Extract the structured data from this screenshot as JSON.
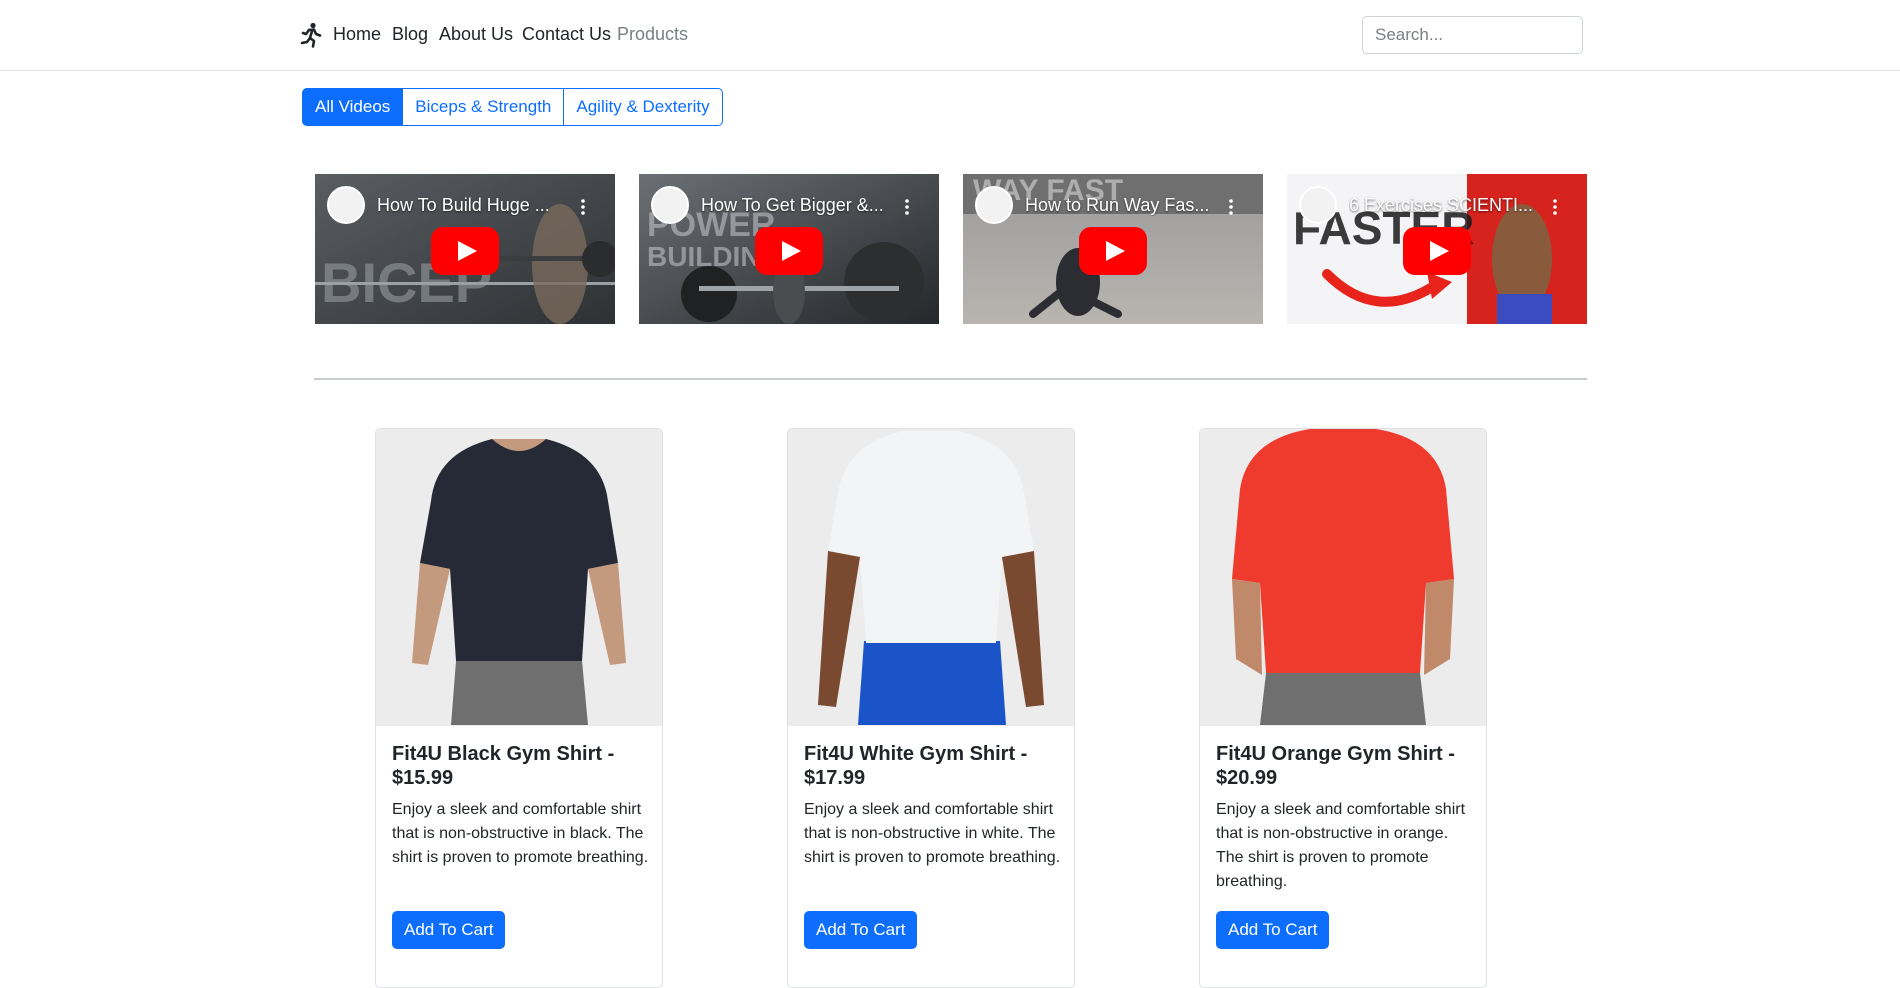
{
  "nav": {
    "brand_icon": "running-person-icon",
    "links": [
      {
        "label": "Home"
      },
      {
        "label": "Blog"
      },
      {
        "label": "About Us"
      },
      {
        "label": "Contact Us"
      },
      {
        "label": "Products"
      }
    ],
    "search_placeholder": "Search..."
  },
  "filters": {
    "buttons": [
      {
        "label": "All Videos",
        "active": true
      },
      {
        "label": "Biceps & Strength",
        "active": false
      },
      {
        "label": "Agility & Dexterity",
        "active": false
      }
    ]
  },
  "videos": [
    {
      "title": "How To Build Huge ...",
      "icon": "youtube-play-icon"
    },
    {
      "title": "How To Get Bigger &...",
      "icon": "youtube-play-icon"
    },
    {
      "title": "How to Run Way Fas...",
      "icon": "youtube-play-icon"
    },
    {
      "title": "6 Exercises SCIENTI...",
      "icon": "youtube-play-icon"
    }
  ],
  "products": [
    {
      "title": "Fit4U Black Gym Shirt - $15.99",
      "description": "Enjoy a sleek and comfortable shirt that is non-obstructive in black. The shirt is proven to promote breathing.",
      "button": "Add To Cart",
      "shirt_color": "#262a36"
    },
    {
      "title": "Fit4U White Gym Shirt - $17.99",
      "description": "Enjoy a sleek and comfortable shirt that is non-obstructive in white. The shirt is proven to promote breathing.",
      "button": "Add To Cart",
      "shirt_color": "#f3f4f6"
    },
    {
      "title": "Fit4U Orange Gym Shirt - $20.99",
      "description": "Enjoy a sleek and comfortable shirt that is non-obstructive in orange. The shirt is proven to promote breathing.",
      "button": "Add To Cart",
      "shirt_color": "#ee3b2e"
    }
  ],
  "colors": {
    "primary": "#0d6efd",
    "youtube_red": "#ff0000",
    "muted_link": "#7a7f85"
  }
}
